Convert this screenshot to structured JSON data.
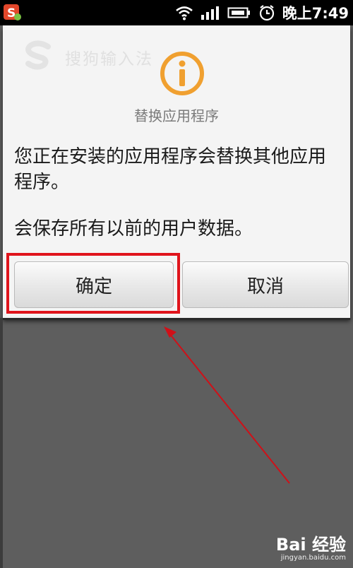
{
  "status_bar": {
    "time": "晚上7:49",
    "app_icon": "sogou-input-icon",
    "icons": [
      "wifi-icon",
      "signal-icon",
      "battery-icon",
      "alarm-icon"
    ]
  },
  "background_app": {
    "title": "搜狗输入法",
    "logo": "sogou-logo-icon"
  },
  "dialog": {
    "icon": "info-icon",
    "title": "替换应用程序",
    "message_line1": "您正在安装的应用程序会替换其他应用程序。",
    "message_line2": "会保存所有以前的用户数据。",
    "ok_label": "确定",
    "cancel_label": "取消"
  },
  "watermark": {
    "logo": "Bai 经验",
    "url": "jingyan.baidu.com"
  },
  "colors": {
    "accent_orange": "#f0a030",
    "annotation_red": "#e0141c",
    "dialog_bg": "#f4f4f4",
    "backdrop": "#5e5e5e"
  }
}
